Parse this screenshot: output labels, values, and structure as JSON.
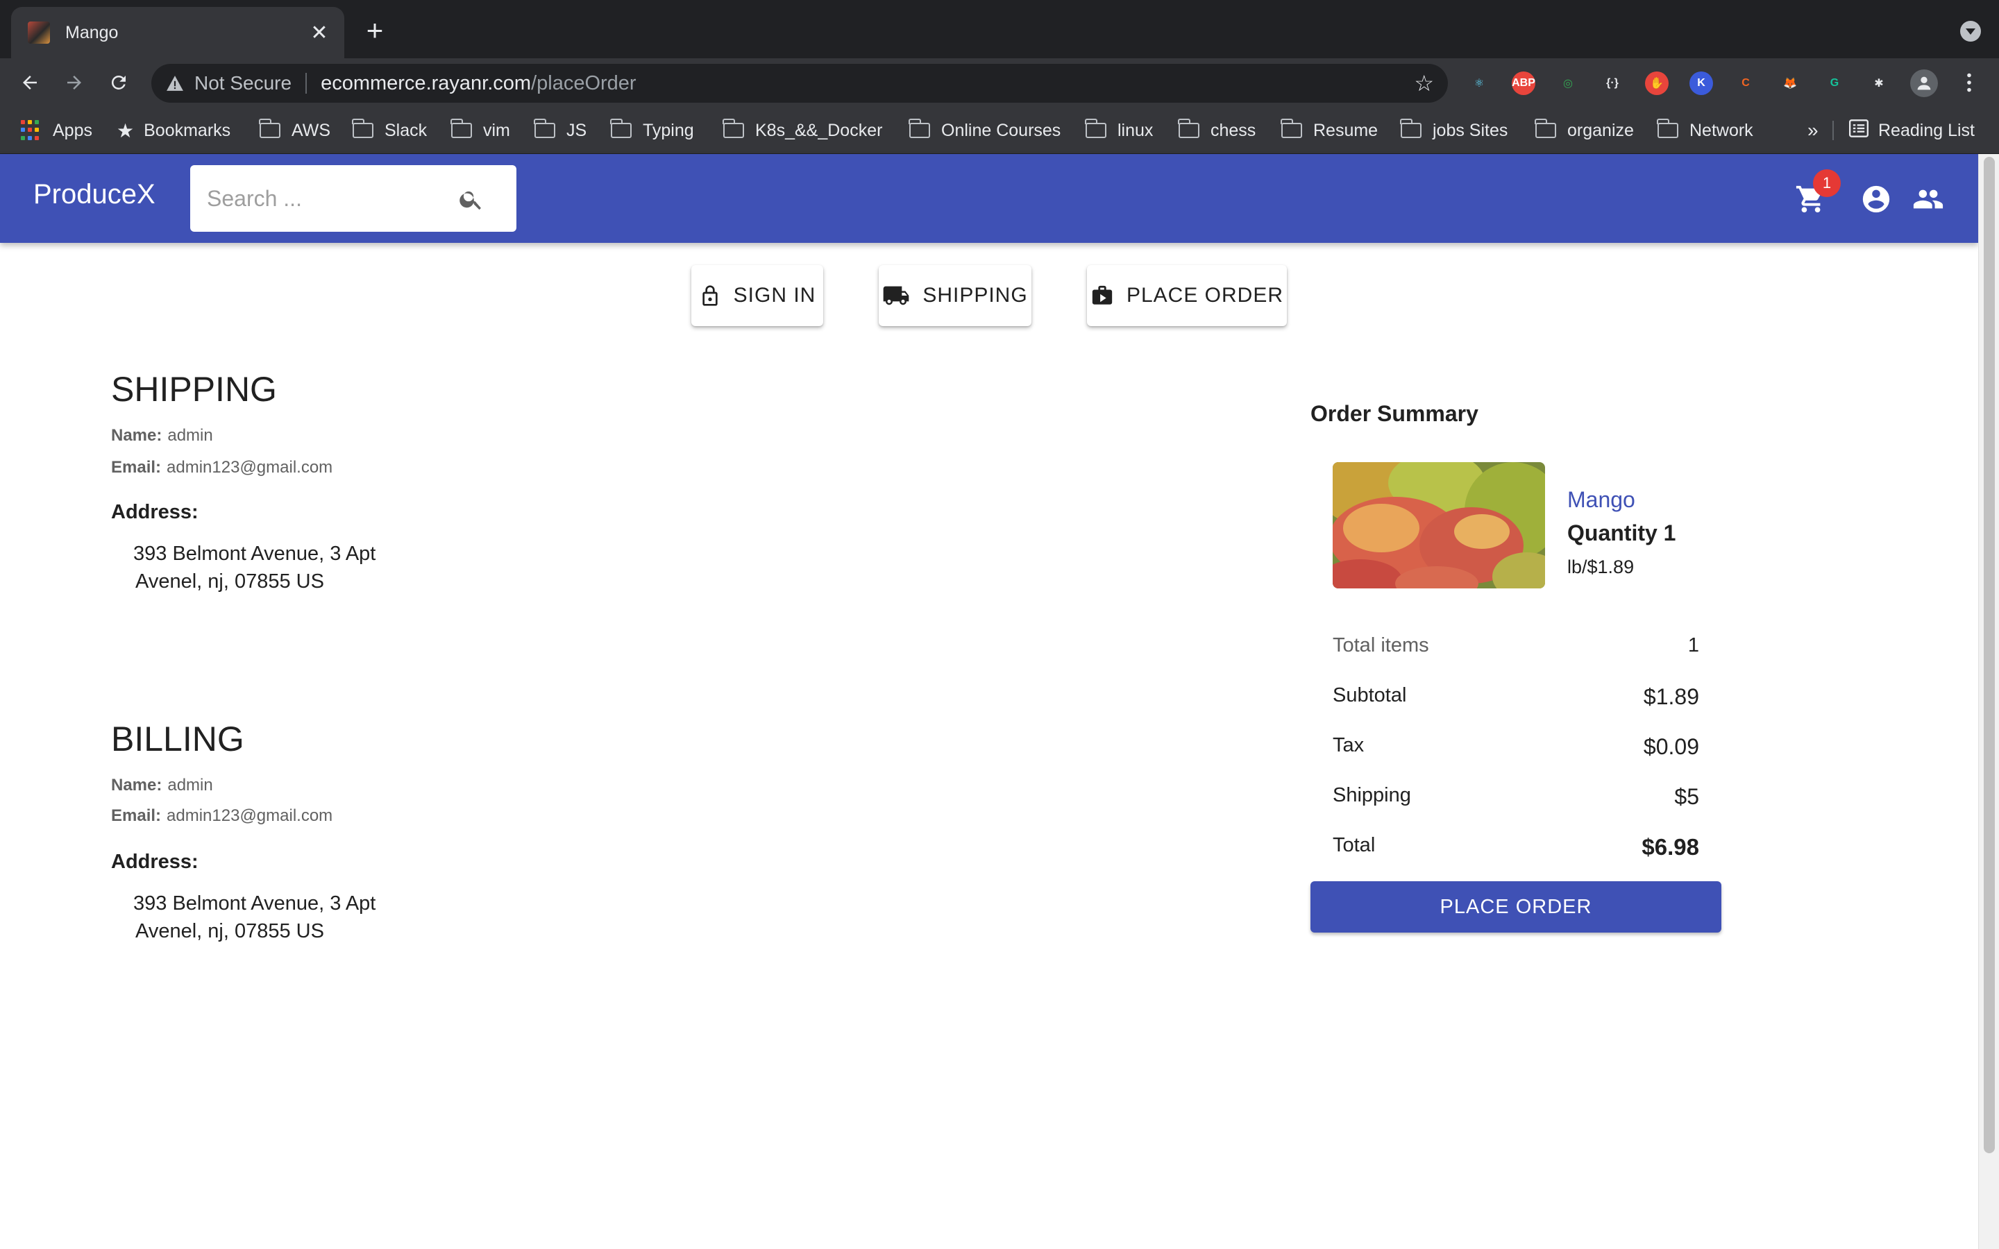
{
  "browser": {
    "tab_title": "Mango",
    "close_glyph": "✕",
    "newtab_glyph": "+",
    "security_label": "Not Secure",
    "url_host": "ecommerce.rayanr.com",
    "url_path": "/placeOrder",
    "extensions": [
      {
        "name": "react-devtools-icon",
        "label": "⚛",
        "color": "#61dafb"
      },
      {
        "name": "adblock-icon",
        "label": "ABP",
        "color": "#e8453c"
      },
      {
        "name": "circle-target-icon",
        "label": "◎",
        "color": "#34a853"
      },
      {
        "name": "json-viewer-icon",
        "label": "{·}",
        "color": "#e8eaed"
      },
      {
        "name": "red-hand-icon",
        "label": "✋",
        "color": "#e8453c"
      },
      {
        "name": "k-extension-icon",
        "label": "K",
        "color": "#3b5bdb"
      },
      {
        "name": "c-extension-icon",
        "label": "C",
        "color": "#f26522"
      },
      {
        "name": "metamask-icon",
        "label": "🦊",
        "color": "#f6851b"
      },
      {
        "name": "grammarly-icon",
        "label": "G",
        "color": "#15c39a"
      },
      {
        "name": "puzzle-extensions-icon",
        "label": "✱",
        "color": "#e8eaed"
      }
    ],
    "bookmarks_overflow": "»",
    "reading_list": "Reading List",
    "bookmarks": [
      "Apps",
      "Bookmarks",
      "AWS",
      "Slack",
      "vim",
      "JS",
      "Typing",
      "K8s_&&_Docker",
      "Online Courses",
      "linux",
      "chess",
      "Resume",
      "jobs Sites",
      "organize",
      "Network"
    ]
  },
  "header": {
    "brand": "ProduceX",
    "search_placeholder": "Search ...",
    "cart_count": "1",
    "brand_color": "#3f51b5"
  },
  "steps": [
    {
      "label": "SIGN IN",
      "icon": "lock-icon"
    },
    {
      "label": "SHIPPING",
      "icon": "truck-icon"
    },
    {
      "label": "PLACE ORDER",
      "icon": "place-order-icon"
    }
  ],
  "shipping": {
    "title": "SHIPPING",
    "name_label": "Name:",
    "name": "admin",
    "email_label": "Email:",
    "email": "admin123@gmail.com",
    "address_label": "Address:",
    "address_line1": "393 Belmont Avenue, 3 Apt",
    "address_line2": "Avenel, nj, 07855 US"
  },
  "billing": {
    "title": "BILLING",
    "name_label": "Name:",
    "name": "admin",
    "email_label": "Email:",
    "email": "admin123@gmail.com",
    "address_label": "Address:",
    "address_line1": "393 Belmont Avenue, 3 Apt",
    "address_line2": "Avenel, nj, 07855 US"
  },
  "summary": {
    "title": "Order Summary",
    "product": {
      "name": "Mango",
      "quantity": "Quantity 1",
      "price": "lb/$1.89"
    },
    "rows": [
      {
        "label": "Total items",
        "value": "1"
      },
      {
        "label": "Subtotal",
        "value": "$1.89"
      },
      {
        "label": "Tax",
        "value": "$0.09"
      },
      {
        "label": "Shipping",
        "value": "$5"
      },
      {
        "label": "Total",
        "value": "$6.98"
      }
    ],
    "button": "PLACE ORDER"
  }
}
